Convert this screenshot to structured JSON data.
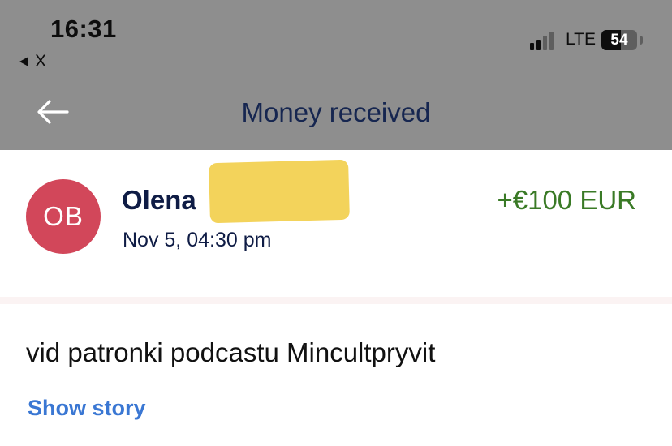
{
  "status_bar": {
    "time": "16:31",
    "back_app_label": "X",
    "network": "LTE",
    "battery_level": "54",
    "battery_fraction": 0.54
  },
  "header": {
    "title": "Money received",
    "back_icon": "arrow-left-icon"
  },
  "transaction": {
    "avatar_initials": "OB",
    "avatar_color": "#d2475a",
    "sender_name": "Olena",
    "amount": "+€100 EUR",
    "amount_color": "#3a7a26",
    "date": "Nov 5, 04:30 pm"
  },
  "details": {
    "note": "vid patronki podcastu Mincultpryvit",
    "show_story_label": "Show story",
    "link_color": "#3a77d3"
  }
}
